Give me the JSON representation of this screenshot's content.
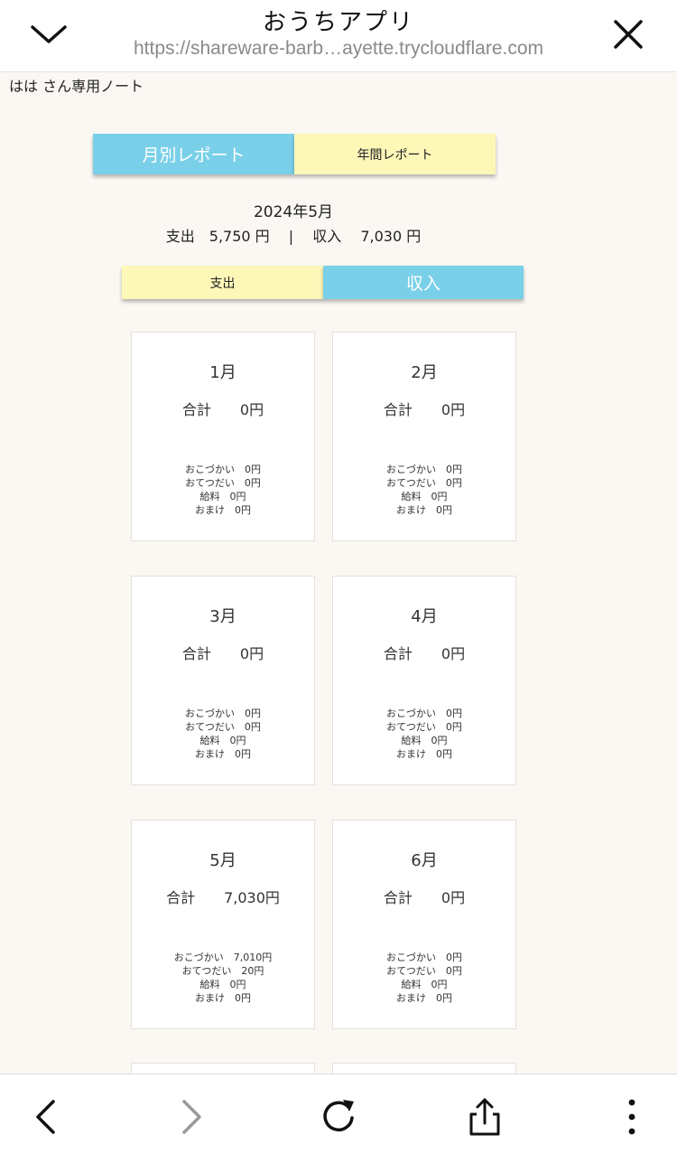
{
  "browser": {
    "title": "おうちアプリ",
    "url": "https://shareware-barb…ayette.trycloudflare.com"
  },
  "note": "はは さん専用ノート",
  "report_tabs": {
    "monthly": "月別レポート",
    "annual": "年間レポート"
  },
  "period": "2024年5月",
  "summary": "支出　5,750 円　 |　 収入　 7,030 円",
  "type_tabs": {
    "expense": "支出",
    "income": "収入"
  },
  "cards": [
    {
      "month": "1月",
      "total": "合計　　0円",
      "items": [
        "おこづかい　0円",
        "おてつだい　0円",
        "給料　0円",
        "おまけ　0円"
      ]
    },
    {
      "month": "2月",
      "total": "合計　　0円",
      "items": [
        "おこづかい　0円",
        "おてつだい　0円",
        "給料　0円",
        "おまけ　0円"
      ]
    },
    {
      "month": "3月",
      "total": "合計　　0円",
      "items": [
        "おこづかい　0円",
        "おてつだい　0円",
        "給料　0円",
        "おまけ　0円"
      ]
    },
    {
      "month": "4月",
      "total": "合計　　0円",
      "items": [
        "おこづかい　0円",
        "おてつだい　0円",
        "給料　0円",
        "おまけ　0円"
      ]
    },
    {
      "month": "5月",
      "total": "合計　　7,030円",
      "items": [
        "おこづかい　7,010円",
        "おてつだい　20円",
        "給料　0円",
        "おまけ　0円"
      ]
    },
    {
      "month": "6月",
      "total": "合計　　0円",
      "items": [
        "おこづかい　0円",
        "おてつだい　0円",
        "給料　0円",
        "おまけ　0円"
      ]
    }
  ],
  "colors": {
    "tab_active": "#7ad0e8",
    "tab_inactive": "#fdf7b8",
    "page_bg": "#fbf8f3"
  },
  "icons": {
    "top_left": "chevron-down-icon",
    "top_right": "close-icon",
    "bottom": [
      "back-icon",
      "forward-icon",
      "reload-icon",
      "share-icon",
      "more-icon"
    ]
  }
}
